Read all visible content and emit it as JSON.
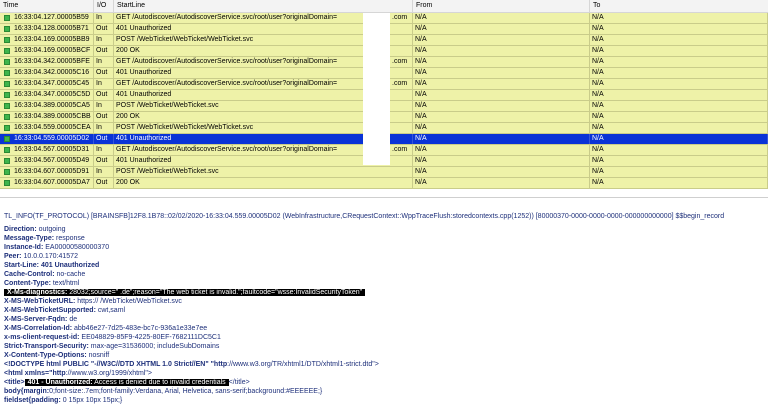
{
  "columns": [
    "Time",
    "I/O",
    "StartLine",
    "From",
    "To"
  ],
  "rows": [
    {
      "time": "16:33:04.127.00005B59",
      "io": "In",
      "start": "GET /Autodiscover/AutodiscoverService.svc/root/user?originalDomain=",
      "tail": ".com",
      "from": "N/A",
      "to": "N/A"
    },
    {
      "time": "16:33:04.128.00005B71",
      "io": "Out",
      "start": "401 Unauthorized",
      "tail": "",
      "from": "N/A",
      "to": "N/A"
    },
    {
      "time": "16:33:04.169.00005BB9",
      "io": "In",
      "start": "POST /WebTicket/WebTicket/WebTicket.svc",
      "tail": "",
      "from": "N/A",
      "to": "N/A"
    },
    {
      "time": "16:33:04.169.00005BCF",
      "io": "Out",
      "start": "200 OK",
      "tail": "",
      "from": "N/A",
      "to": "N/A"
    },
    {
      "time": "16:33:04.342.00005BFE",
      "io": "In",
      "start": "GET /Autodiscover/AutodiscoverService.svc/root/user?originalDomain=",
      "tail": ".com",
      "from": "N/A",
      "to": "N/A"
    },
    {
      "time": "16:33:04.342.00005C16",
      "io": "Out",
      "start": "401 Unauthorized",
      "tail": "",
      "from": "N/A",
      "to": "N/A"
    },
    {
      "time": "16:33:04.347.00005C45",
      "io": "In",
      "start": "GET /Autodiscover/AutodiscoverService.svc/root/user?originalDomain=",
      "tail": ".com",
      "from": "N/A",
      "to": "N/A"
    },
    {
      "time": "16:33:04.347.00005C5D",
      "io": "Out",
      "start": "401 Unauthorized",
      "tail": "",
      "from": "N/A",
      "to": "N/A"
    },
    {
      "time": "16:33:04.389.00005CA5",
      "io": "In",
      "start": "POST /WebTicket/WebTicket.svc",
      "tail": "",
      "from": "N/A",
      "to": "N/A"
    },
    {
      "time": "16:33:04.389.00005CBB",
      "io": "Out",
      "start": "200 OK",
      "tail": "",
      "from": "N/A",
      "to": "N/A"
    },
    {
      "time": "16:33:04.559.00005CEA",
      "io": "In",
      "start": "POST /WebTicket/WebTicket/WebTicket.svc",
      "tail": "",
      "from": "N/A",
      "to": "N/A"
    },
    {
      "time": "16:33:04.559.00005D02",
      "io": "Out",
      "start": "401 Unauthorized",
      "tail": "",
      "from": "N/A",
      "to": "N/A",
      "selected": true
    },
    {
      "time": "16:33:04.567.00005D31",
      "io": "In",
      "start": "GET /Autodiscover/AutodiscoverService.svc/root/user?originalDomain=",
      "tail": ".com",
      "from": "N/A",
      "to": "N/A"
    },
    {
      "time": "16:33:04.567.00005D49",
      "io": "Out",
      "start": "401 Unauthorized",
      "tail": "",
      "from": "N/A",
      "to": "N/A"
    },
    {
      "time": "16:33:04.607.00005D91",
      "io": "In",
      "start": "POST /WebTicket/WebTicket.svc",
      "tail": "",
      "from": "N/A",
      "to": "N/A"
    },
    {
      "time": "16:33:04.607.00005DA7",
      "io": "Out",
      "start": "200 OK",
      "tail": "",
      "from": "N/A",
      "to": "N/A"
    }
  ],
  "detail": {
    "trace": "TL_INFO(TF_PROTOCOL) [BRAINSFB]12F8.1B78::02/02/2020-16:33:04.559.00005D02 (WebInfrastructure,CRequestContext::WppTraceFlush:storedcontexts.cpp(1252)) [80000370-0000-0000-0000-000000000000] $$begin_record",
    "lines": [
      {
        "key": "Direction:",
        "val": " outgoing"
      },
      {
        "key": "Message-Type:",
        "val": " response"
      },
      {
        "key": "Instance-Id:",
        "val": " EA00000580000370"
      },
      {
        "key": "Peer:",
        "val": " 10.0.0.170:41572"
      },
      {
        "key": "Start-Line: 401 Unauthorized",
        "val": ""
      },
      {
        "key": "Cache-Control:",
        "val": " no-cache"
      },
      {
        "key": "Content-Type:",
        "val": " text/html"
      },
      {
        "key": "X-Ms-diagnostics:",
        "val": " 28032;source=\"                                                       .de\";reason=\"The web ticket is invalid.\";faultcode=\"wsse:InvalidSecurityToken\"",
        "hl": true
      },
      {
        "key": "X-MS-WebTicketURL:",
        "val": " https://                    /WebTicket/WebTicket.svc"
      },
      {
        "key": "X-MS-WebTicketSupported:",
        "val": " cwt,saml"
      },
      {
        "key": "X-MS-Server-Fqdn:",
        "val": "                                        de"
      },
      {
        "key": "X-MS-Correlation-Id:",
        "val": " abb46e27-7d25-483e-bc7c-936a1e33e7ee"
      },
      {
        "key": "x-ms-client-request-id:",
        "val": " EE048829-85F9-4225-80EF-7682111DC5C1"
      },
      {
        "key": "Strict-Transport-Security:",
        "val": " max-age=31536000; includeSubDomains"
      },
      {
        "key": "X-Content-Type-Options:",
        "val": " nosniff"
      },
      {
        "key": "<!DOCTYPE html PUBLIC \"-//W3C//DTD XHTML 1.0 Strict//EN\" \"http",
        "val": "://www.w3.org/TR/xhtml1/DTD/xhtml1-strict.dtd\">"
      },
      {
        "key": "<html xmlns=\"http",
        "val": "://www.w3.org/1999/xhtml\">"
      },
      {
        "key": "<title>",
        "val": "",
        "title": true,
        "t_bold": "401 - Unauthorized:",
        "t_rest": " Access is denied due to invalid credentials",
        "t_end": "</title>"
      },
      {
        "key": "body{margin:",
        "val": "0;font-size:.7em;font-family:Verdana, Arial, Helvetica, sans-serif;background:#EEEEEE;}"
      },
      {
        "key": "fieldset{padding:",
        "val": " 0 15px 10px 15px;}"
      }
    ]
  }
}
